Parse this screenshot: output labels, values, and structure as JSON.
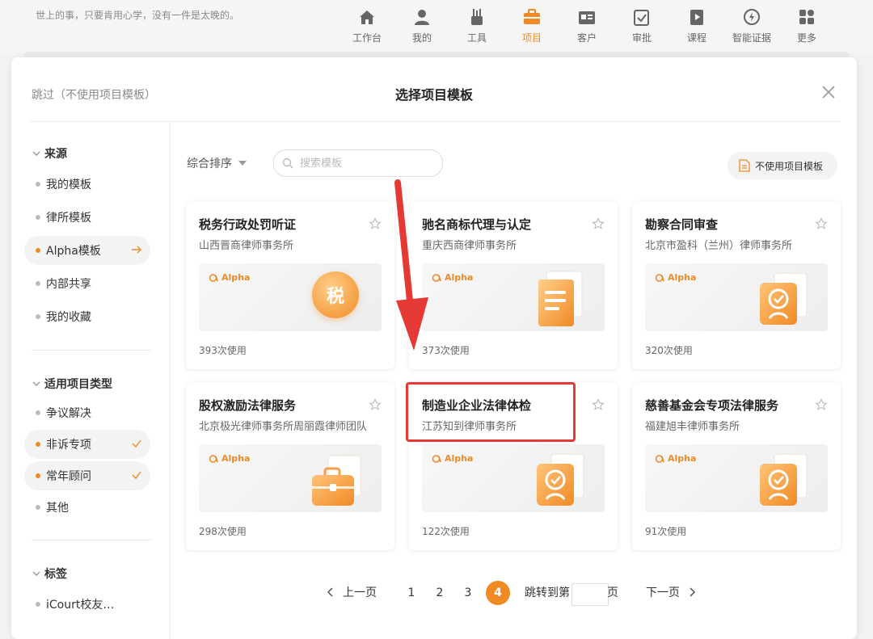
{
  "app": {
    "motto": "世上的事，只要肯用心学，没有一件是太晚的。",
    "accent": "#f08a24",
    "nav": [
      {
        "label": "工作台",
        "icon": "home-icon"
      },
      {
        "label": "我的",
        "icon": "person-icon"
      },
      {
        "label": "工具",
        "icon": "tools-icon"
      },
      {
        "label": "项目",
        "icon": "briefcase-icon",
        "active": true
      },
      {
        "label": "客户",
        "icon": "contact-card-icon"
      },
      {
        "label": "审批",
        "icon": "approval-icon"
      },
      {
        "label": "课程",
        "icon": "play-doc-icon"
      },
      {
        "label": "智能证据",
        "icon": "evidence-icon"
      },
      {
        "label": "更多",
        "icon": "grid-more-icon"
      }
    ]
  },
  "modal": {
    "skip": "跳过（不使用项目模板）",
    "title": "选择项目模板",
    "sidebar": {
      "source": {
        "heading": "来源",
        "items": [
          "我的模板",
          "律所模板",
          "Alpha模板",
          "内部共享",
          "我的收藏"
        ],
        "selected": "Alpha模板"
      },
      "types": {
        "heading": "适用项目类型",
        "items": [
          "争议解决",
          "非诉专项",
          "常年顾问",
          "其他"
        ],
        "checked": [
          "非诉专项",
          "常年顾问"
        ]
      },
      "tags": {
        "heading": "标签",
        "items": [
          "iCourt校友…"
        ]
      }
    },
    "toolbar": {
      "sort": "综合排序",
      "search_placeholder": "搜索模板",
      "no_template": "不使用项目模板"
    },
    "badge": "Alpha",
    "cards": [
      {
        "title": "税务行政处罚听证",
        "firm": "山西晋商律师事务所",
        "usage": "393次使用",
        "illustration": "tax-badge-icon",
        "glyph": "税"
      },
      {
        "title": "驰名商标代理与认定",
        "firm": "重庆西商律师事务所",
        "usage": "373次使用",
        "illustration": "documents-icon"
      },
      {
        "title": "勘察合同审查",
        "firm": "北京市盈科（兰州）律师事务所",
        "usage": "320次使用",
        "illustration": "certificate-icon"
      },
      {
        "title": "股权激励法律服务",
        "firm": "北京极光律师事务所周丽霞律师团队",
        "usage": "298次使用",
        "illustration": "briefcase-icon"
      },
      {
        "title": "制造业企业法律体检",
        "firm": "江苏知到律师事务所",
        "usage": "122次使用",
        "illustration": "certificate-icon"
      },
      {
        "title": "慈善基金会专项法律服务",
        "firm": "福建旭丰律师事务所",
        "usage": "91次使用",
        "illustration": "certificate-icon"
      }
    ],
    "pagination": {
      "prev": "上一页",
      "pages": [
        "1",
        "2",
        "3",
        "4"
      ],
      "current": "4",
      "jump_prefix": "跳转到第",
      "jump_suffix": "页",
      "next": "下一页"
    }
  },
  "annotation": {
    "arrow_color": "#e53935",
    "box_color": "#e53935"
  }
}
